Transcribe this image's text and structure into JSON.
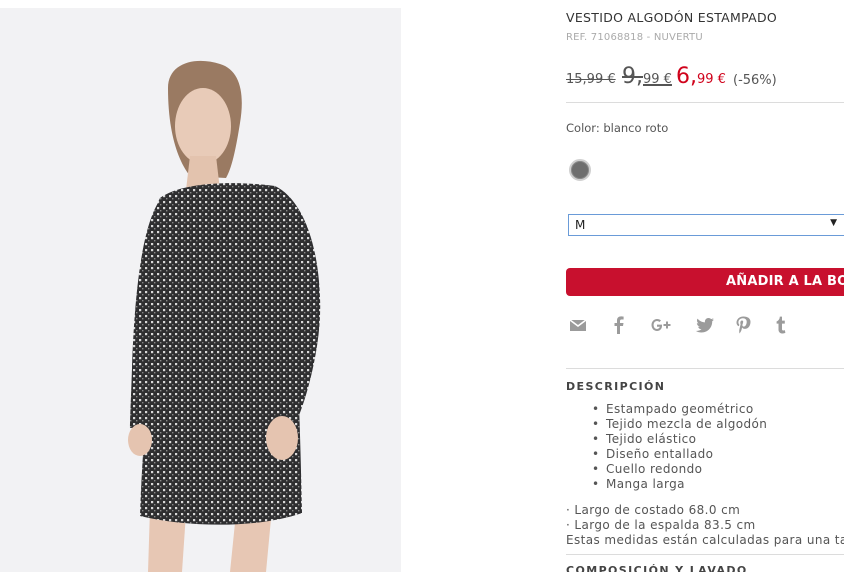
{
  "product": {
    "title": "VESTIDO ALGODÓN ESTAMPADO",
    "ref": "REF. 71068818 - NUVERTU",
    "image_alt": "model-wearing-printed-dress"
  },
  "prices": {
    "original": "15,99 €",
    "previous_int": "9,",
    "previous_dec": "99 €",
    "current_int": "6,",
    "current_dec": "99 €",
    "discount": "(-56%)",
    "current_color": "#d0021b"
  },
  "color": {
    "label": "Color: blanco roto",
    "swatch_hex": "#6e6e6e"
  },
  "size_select": {
    "value": "M",
    "caret": "▼"
  },
  "add_to_bag": {
    "label": "AÑADIR A LA BOLSA",
    "bg": "#c8102e"
  },
  "share": {
    "icons": [
      "mail-icon",
      "facebook-icon",
      "google-plus-icon",
      "twitter-icon",
      "pinterest-icon",
      "tumblr-icon"
    ],
    "icon_color": "#9b9b9b"
  },
  "description": {
    "heading": "DESCRIPCIÓN",
    "items": [
      "Estampado geométrico",
      "Tejido mezcla de algodón",
      "Tejido elástico",
      "Diseño entallado",
      "Cuello redondo",
      "Manga larga"
    ],
    "measures": [
      "· Largo de costado 68.0 cm",
      "· Largo de la espalda 83.5 cm",
      "Estas medidas están calculadas para una talla M"
    ]
  },
  "composition": {
    "heading": "COMPOSICIÓN Y LAVADO"
  }
}
